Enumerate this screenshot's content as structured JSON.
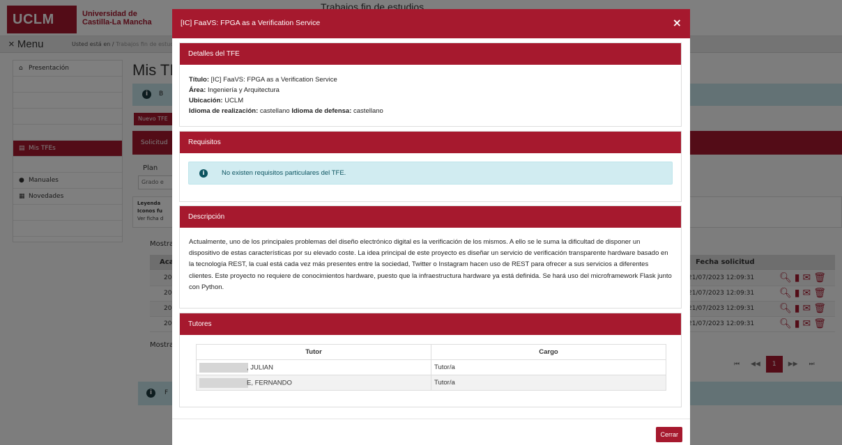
{
  "background": {
    "logo_text": "UCLM",
    "university_name": "Universidad de Castilla-La Mancha",
    "page_heading": "Trabajos fin de estudios",
    "menu_label": "× Menu",
    "breadcrumb": {
      "prefix": "Usted está en /",
      "link": "Trabajos fin de estudio"
    },
    "sidebar": [
      {
        "label": "Presentación",
        "icon": "home-icon"
      },
      {
        "label": "Mis TFEs",
        "icon": "document-icon",
        "active": true
      },
      {
        "label": "Manuales",
        "icon": "info-icon"
      },
      {
        "label": "Novedades",
        "icon": "news-icon"
      }
    ],
    "main_title": "Mis TI",
    "info_text": "B",
    "new_button": "Nuevo TFE",
    "band_text": "Solicitud",
    "plan_label": "Plan",
    "plan_value": "Grado e",
    "legend_lines": [
      "Leyenda",
      "Iconos fu",
      "Ver ficha d"
    ],
    "mostrar_top": "Mostra",
    "mostrar_bottom": "Mostra",
    "table_headers": {
      "first": "Aca",
      "date": "Fecha solicitud"
    },
    "rows": [
      {
        "first": "20",
        "date": "21/07/2023 12:09:31"
      },
      {
        "first": "20",
        "date": "21/07/2023 12:09:31"
      },
      {
        "first": "20",
        "date": "21/07/2023 12:09:31"
      },
      {
        "first": "20",
        "date": "21/07/2023 12:09:31"
      }
    ],
    "pager": {
      "first": "⏮",
      "prev": "◀◀",
      "current": "1",
      "next": "▶▶",
      "last": "⏭"
    },
    "bottom_info_text": "F"
  },
  "modal": {
    "title": "[IC] FaaVS: FPGA as a Verification Service",
    "close_icon": "×",
    "sections": {
      "detalles": {
        "header": "Detalles del TFE",
        "titulo_label": "Título:",
        "titulo_value": "[IC] FaaVS: FPGA as a Verification Service",
        "area_label": "Área:",
        "area_value": "Ingeniería y Arquitectura",
        "ubicacion_label": "Ubicación:",
        "ubicacion_value": "UCLM",
        "idioma_real_label": "Idioma de realización:",
        "idioma_real_value": "castellano",
        "idioma_def_label": "Idioma de defensa:",
        "idioma_def_value": "castellano"
      },
      "requisitos": {
        "header": "Requisitos",
        "alert_text": "No existen requisitos particulares del TFE."
      },
      "descripcion": {
        "header": "Descripción",
        "text": "Actualmente, uno de los principales problemas del diseño electrónico digital es la verificación de los mismos. A ello se le suma la dificultad de disponer un dispositivo de estas características por su elevado coste. La idea principal de este proyecto es diseñar un servicio de verificación transparente hardware basado en la tecnología REST, la cual está cada vez más presentes entre la sociedad, Twitter o Instagram hacen uso de REST para ofrecer a sus servicios a diferentes clientes. Este proyecto no requiere de conocimientos hardware, puesto que la infraestructura hardware ya está definida. Se hará uso del microframework Flask junto con Python."
      },
      "tutores": {
        "header": "Tutores",
        "columns": [
          "Tutor",
          "Cargo"
        ],
        "rows": [
          {
            "tutor": ", JULIAN",
            "cargo": "Tutor/a"
          },
          {
            "tutor": "E, FERNANDO",
            "cargo": "Tutor/a"
          }
        ]
      }
    },
    "close_button": "Cerrar"
  },
  "colors": {
    "brand": "#a6192e",
    "info_bg": "#d1ecf1",
    "info_text": "#0c5460"
  }
}
